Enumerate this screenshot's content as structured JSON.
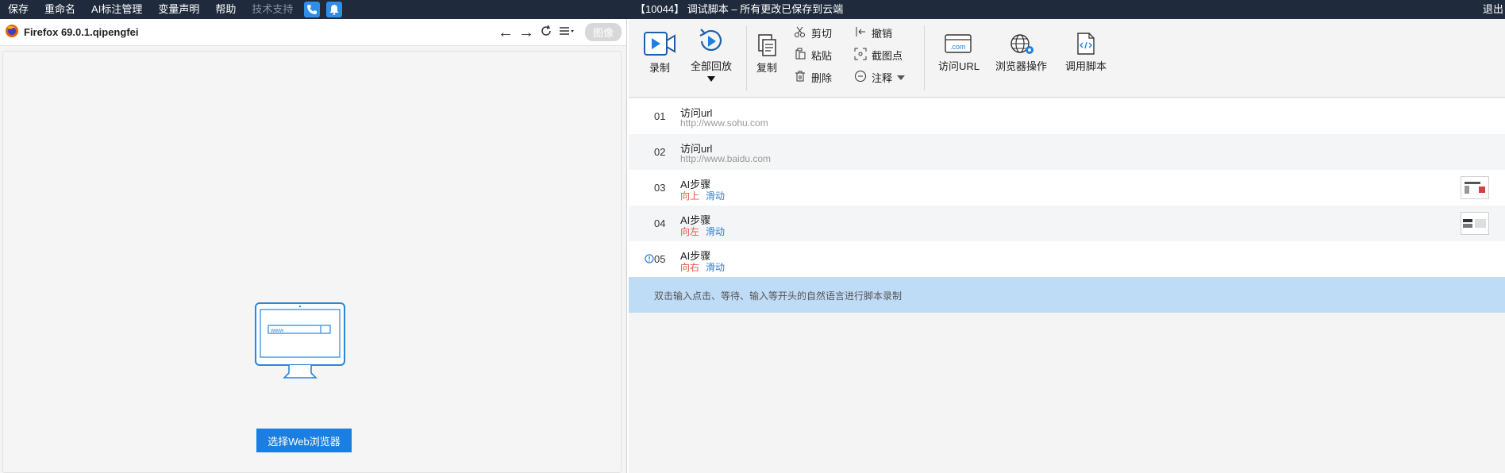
{
  "menu": {
    "items": [
      "保存",
      "重命名",
      "AI标注管理",
      "变量声明",
      "帮助"
    ],
    "disabled_item": "技术支持",
    "title": "【10044】 调试脚本 – 所有更改已保存到云端",
    "right_label": "退出"
  },
  "browser": {
    "title": "Firefox 69.0.1.qipengfei",
    "image_pill": "图像",
    "url_placeholder": "www",
    "choose_button": "选择Web浏览器"
  },
  "toolbar": {
    "record": "录制",
    "replay_all": "全部回放",
    "copy": "复制",
    "cut": "剪切",
    "paste": "粘贴",
    "delete": "删除",
    "undo": "撤销",
    "capture_point": "截图点",
    "comment": "注释",
    "visit_url": "访问URL",
    "browser_ops": "浏览器操作",
    "call_script": "调用脚本",
    "com_badge": ".com"
  },
  "steps": [
    {
      "num": "01",
      "title": "访问url",
      "sub": "http://www.sohu.com"
    },
    {
      "num": "02",
      "title": "访问url",
      "sub": "http://www.baidu.com"
    },
    {
      "num": "03",
      "title": "AI步骤",
      "dir": "向上",
      "act": "滑动"
    },
    {
      "num": "04",
      "title": "AI步骤",
      "dir": "向左",
      "act": "滑动"
    },
    {
      "num": "05",
      "title": "AI步骤",
      "dir": "向右",
      "act": "滑动"
    }
  ],
  "hint": "双击输入点击、等待、输入等开头的自然语言进行脚本录制",
  "colors": {
    "menubar": "#1f2b3d",
    "accent": "#1a7fe0",
    "hint_bg": "#bfdcf7",
    "direction": "#e25a4c",
    "action": "#2a7ed6"
  }
}
